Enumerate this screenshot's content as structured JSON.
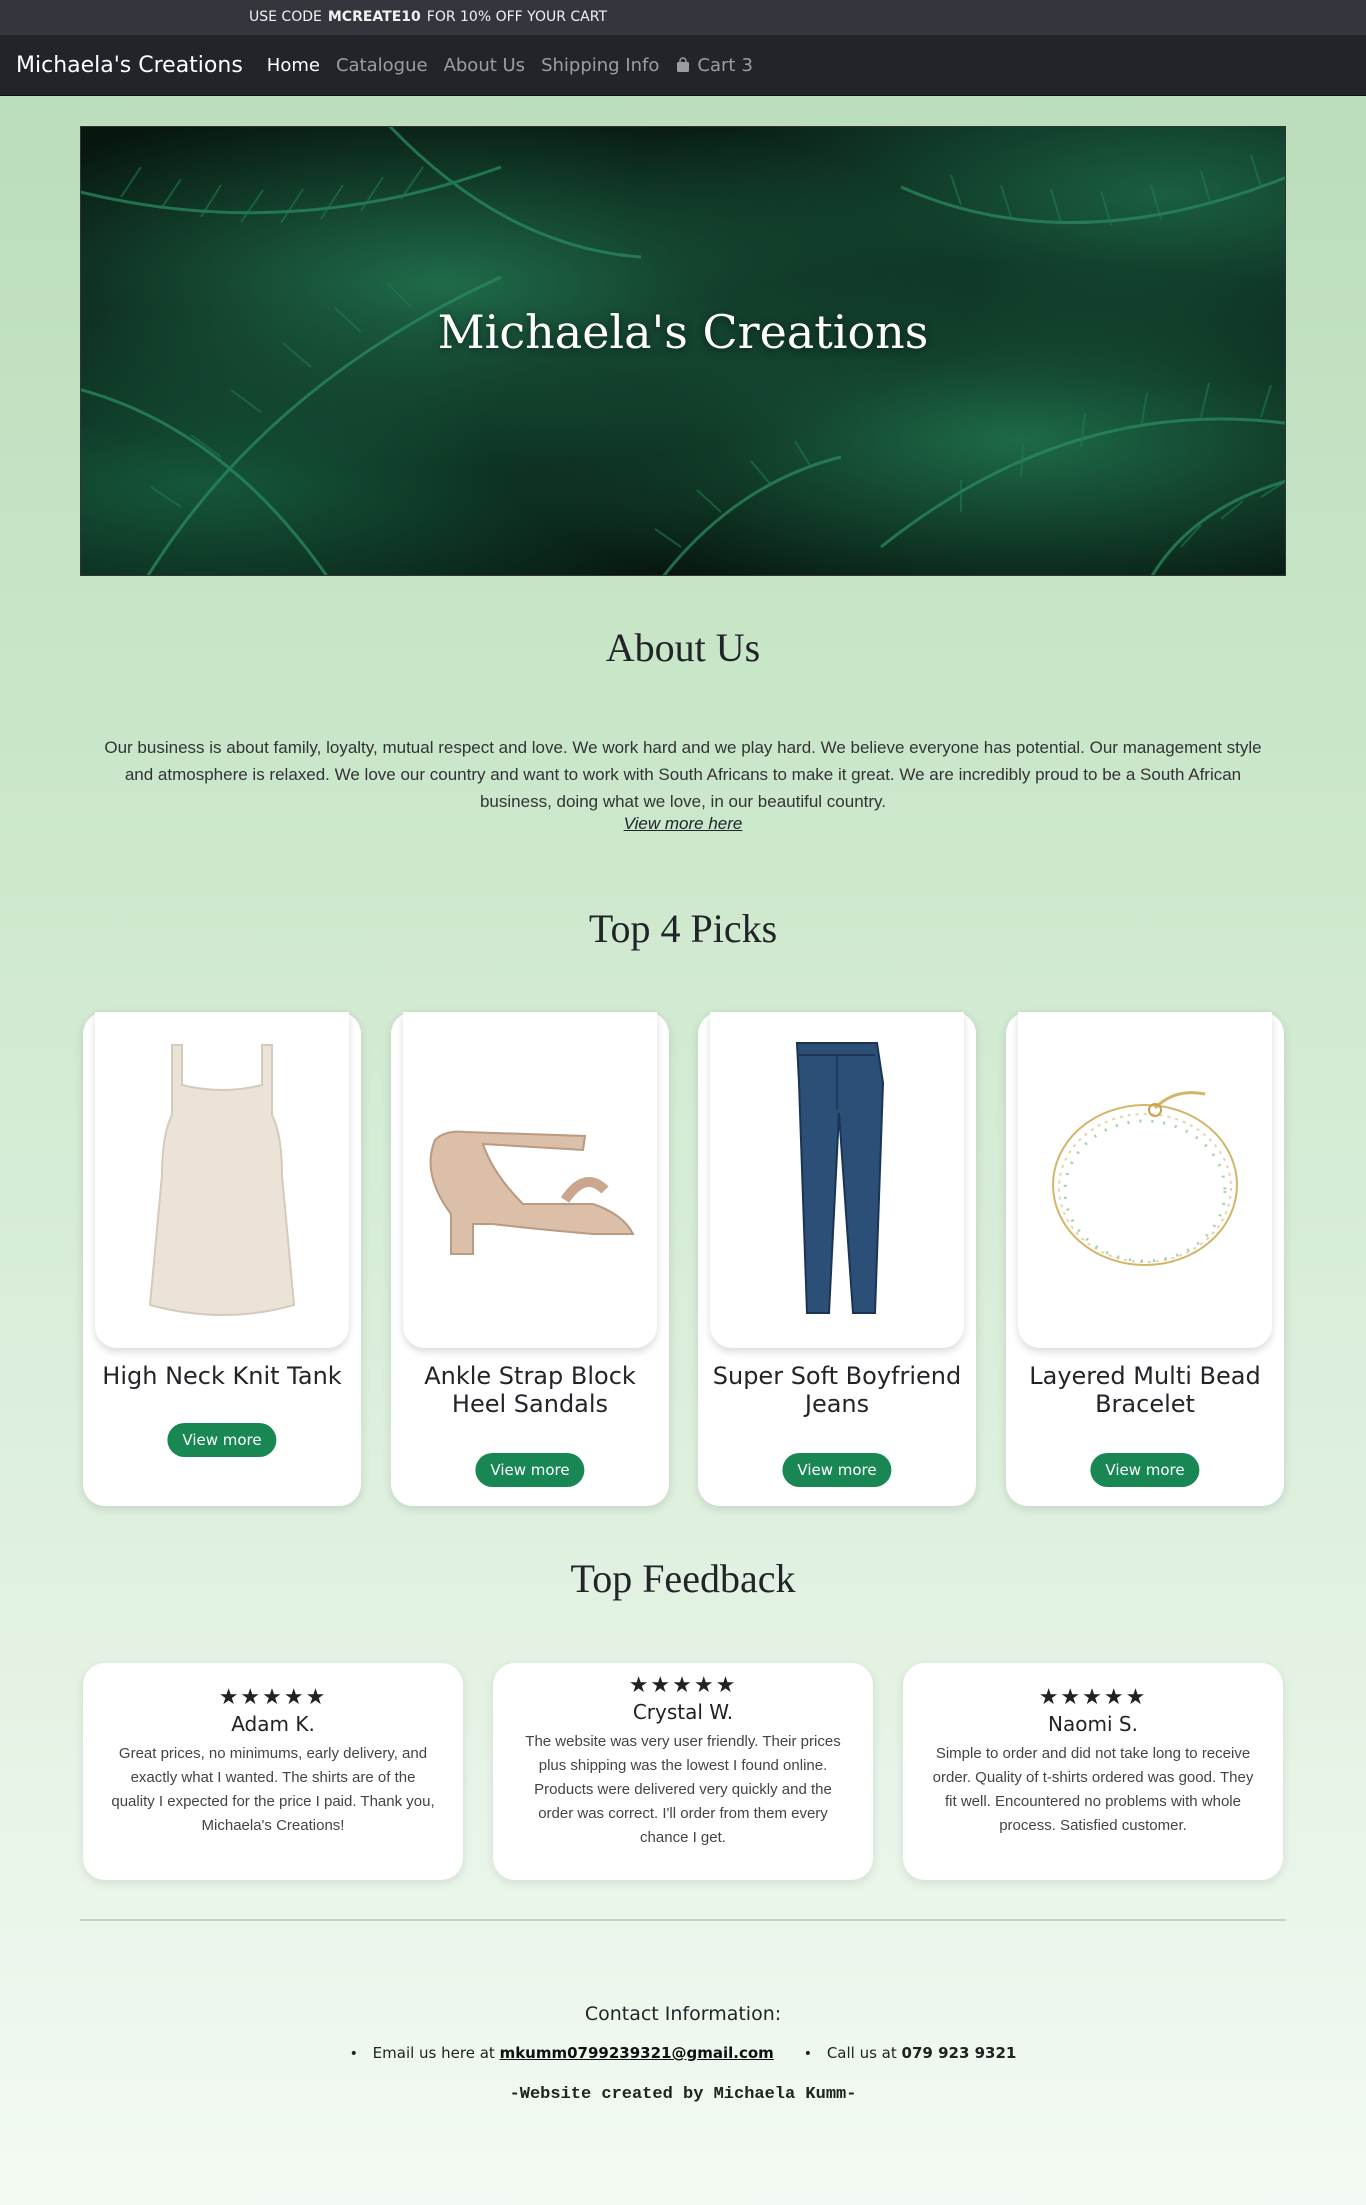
{
  "promo": {
    "prefix": "USE CODE",
    "code": "MCREATE10",
    "suffix": "FOR 10% OFF YOUR CART"
  },
  "nav": {
    "brand": "Michaela's Creations",
    "links": [
      "Home",
      "Catalogue",
      "About Us",
      "Shipping Info"
    ],
    "cart_label": "Cart",
    "cart_count": "3"
  },
  "hero": {
    "title": "Michaela's Creations"
  },
  "about": {
    "heading": "About Us",
    "text": "Our business is about family, loyalty, mutual respect and love. We work hard and we play hard. We believe everyone has potential. Our management style and atmosphere is relaxed. We love our country and want to work with South Africans to make it great. We are incredibly proud to be a South African business, doing what we love, in our beautiful country.",
    "link": "View more here"
  },
  "picks": {
    "heading": "Top 4 Picks",
    "items": [
      {
        "title": "High Neck Knit Tank",
        "button": "View more",
        "icon": "tank-top-icon"
      },
      {
        "title": "Ankle Strap Block Heel Sandals",
        "button": "View more",
        "icon": "sandal-icon"
      },
      {
        "title": "Super Soft Boyfriend Jeans",
        "button": "View more",
        "icon": "jeans-icon"
      },
      {
        "title": "Layered Multi Bead Bracelet",
        "button": "View more",
        "icon": "bracelet-icon"
      }
    ]
  },
  "feedback": {
    "heading": "Top Feedback",
    "items": [
      {
        "stars": "★★★★★",
        "name": "Adam K.",
        "text": "Great prices, no minimums, early delivery, and exactly what I wanted. The shirts are of the quality I expected for the price I paid. Thank you, Michaela's Creations!"
      },
      {
        "stars": "★★★★★",
        "name": "Crystal W.",
        "text": "The website was very user friendly. Their prices plus shipping was the lowest I found online. Products were delivered very quickly and the order was correct. I'll order from them every chance I get."
      },
      {
        "stars": "★★★★★",
        "name": "Naomi S.",
        "text": "Simple to order and did not take long to receive order. Quality of t-shirts ordered was good. They fit well. Encountered no problems with whole process. Satisfied customer."
      }
    ]
  },
  "contact": {
    "heading": "Contact Information:",
    "email_prefix": "Email us here at",
    "email": "mkumm0799239321@gmail.com",
    "phone_prefix": "Call us at",
    "phone": "079 923 9321"
  },
  "credit": "-Website created by Michaela Kumm-",
  "colors": {
    "accent": "#198754",
    "navbar": "#212529",
    "promo": "#33373d"
  }
}
